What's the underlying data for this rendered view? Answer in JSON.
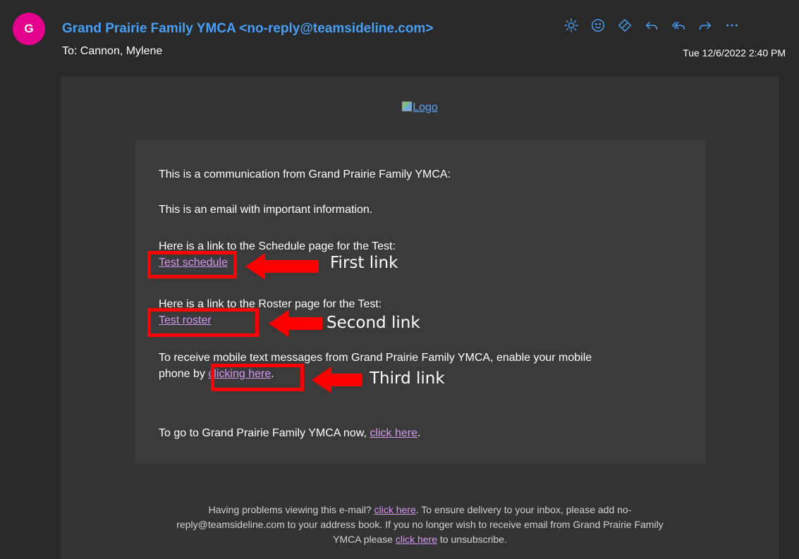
{
  "header": {
    "avatar_initial": "G",
    "sender": "Grand Prairie Family YMCA <no-reply@teamsideline.com>",
    "to_line": "To: Cannon, Mylene",
    "date": "Tue 12/6/2022 2:40 PM",
    "actions": [
      {
        "icon": "sun-icon"
      },
      {
        "icon": "emoji-icon"
      },
      {
        "icon": "sticker-icon"
      },
      {
        "icon": "reply-icon"
      },
      {
        "icon": "reply-all-icon"
      },
      {
        "icon": "forward-icon"
      },
      {
        "icon": "more-icon"
      }
    ]
  },
  "email": {
    "logo_alt": "Logo",
    "intro": "This is a communication from Grand Prairie Family YMCA:",
    "important": "This is an email with important information.",
    "schedule_text": "Here is a link to the Schedule page for the Test:",
    "schedule_link": "Test schedule",
    "roster_text": "Here is a link to the Roster page for the Test:",
    "roster_link": "Test roster",
    "mobile_text_1": "To receive mobile text messages from Grand Prairie Family YMCA, enable your mobile",
    "mobile_text_2": "phone by ",
    "mobile_link": "clicking here",
    "mobile_end": ".",
    "goto_text": "To go to Grand Prairie Family YMCA now, ",
    "goto_link": "click here",
    "goto_end": "."
  },
  "annotations": {
    "first": "First link",
    "second": "Second link",
    "third": "Third link",
    "color": "#ff0000"
  },
  "footer": {
    "line1_a": "Having problems viewing this e-mail? ",
    "line1_link": "click here",
    "line1_b": ". To ensure delivery to your inbox, please add no-",
    "line2": "reply@teamsideline.com to your address book. If you no longer wish to receive email from Grand Prairie Family",
    "line3_a": "YMCA please ",
    "line3_link": "click here",
    "line3_b": " to unsubscribe."
  },
  "colors": {
    "background": "#292929",
    "card": "#333333",
    "content_box": "#3a3a3a",
    "sender": "#479ef5",
    "link": "#d597f0",
    "avatar": "#e3008c"
  }
}
